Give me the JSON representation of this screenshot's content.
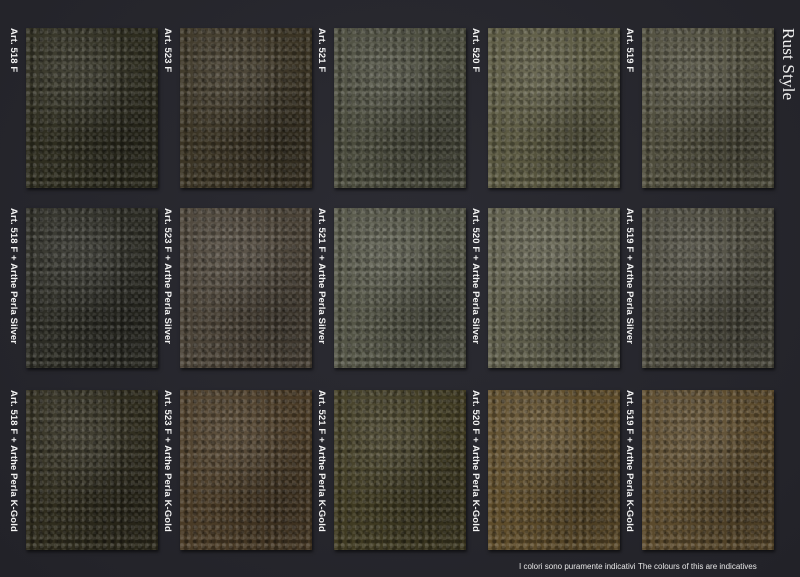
{
  "title": "Rust Style",
  "rows": [
    {
      "items": [
        {
          "label": "Art. 518 F",
          "color": "#2e2d1f"
        },
        {
          "label": "Art. 523 F",
          "color": "#3b3424"
        },
        {
          "label": "Art. 521 F",
          "color": "#4a4b3c"
        },
        {
          "label": "Art. 520 F",
          "color": "#5a5840"
        },
        {
          "label": "Art. 519 F",
          "color": "#4f4d3c"
        }
      ]
    },
    {
      "items": [
        {
          "label": "Art. 518 F + Arthe Perla Silver",
          "color": "#2c2c24"
        },
        {
          "label": "Art. 523 F + Arthe Perla Silver",
          "color": "#4a4236"
        },
        {
          "label": "Art. 521 F + Arthe Perla Silver",
          "color": "#545546"
        },
        {
          "label": "Art. 520 F + Arthe Perla Silver",
          "color": "#5f5e4b"
        },
        {
          "label": "Art. 519 F + Arthe Perla Silver",
          "color": "#4c4a3d"
        }
      ]
    },
    {
      "items": [
        {
          "label": "Art. 518 F + Arthe Perla K-Gold",
          "color": "#2f2c1d"
        },
        {
          "label": "Art. 523 F + Arthe Perla K-Gold",
          "color": "#4a3b26"
        },
        {
          "label": "Art. 521 F + Arthe Perla K-Gold",
          "color": "#403b22"
        },
        {
          "label": "Art. 520 F + Arthe Perla K-Gold",
          "color": "#5e4c2a"
        },
        {
          "label": "Art. 519 F + Arthe Perla K-Gold",
          "color": "#5b4a2c"
        }
      ]
    }
  ],
  "footer": {
    "note_it": "I colori sono puramente indicativi",
    "note_en": "The colours of this are indicatives"
  }
}
